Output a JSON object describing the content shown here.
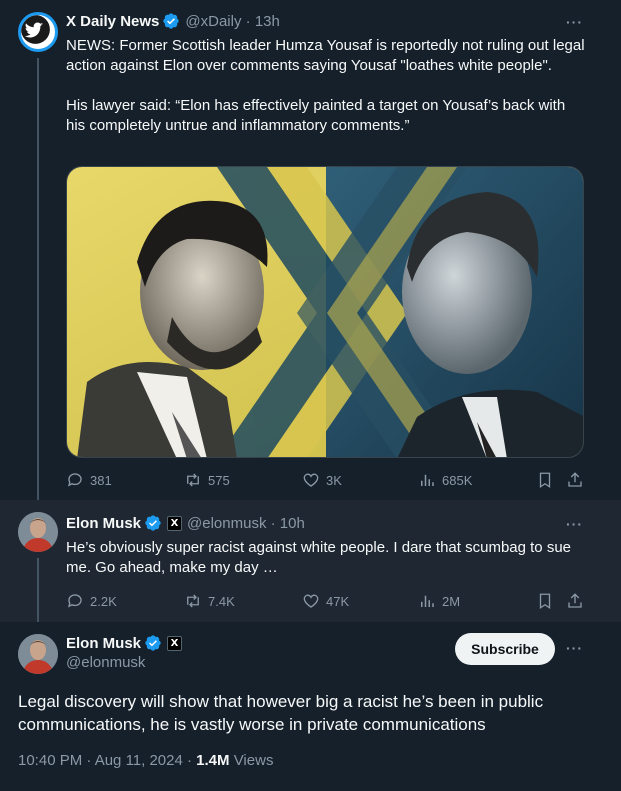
{
  "post1": {
    "name": "X Daily News",
    "handle": "@xDaily",
    "time": "13h",
    "more": "···",
    "text_p1": "NEWS: Former Scottish leader Humza Yousaf is reportedly not ruling out legal action against Elon over comments saying Yousaf \"loathes white people\".",
    "text_p2": "His lawyer said: “Elon has effectively painted a target on Yousaf’s back with his completely untrue and inflammatory comments.”",
    "replies": "381",
    "reposts": "575",
    "likes": "3K",
    "views": "685K"
  },
  "post2": {
    "name": "Elon Musk",
    "handle": "@elonmusk",
    "time": "10h",
    "more": "···",
    "affiliate_badge": "X",
    "text": "He’s obviously super racist against white people. I dare that scumbag to sue me. Go ahead, make my day …",
    "replies": "2.2K",
    "reposts": "7.4K",
    "likes": "47K",
    "views": "2M"
  },
  "post3": {
    "name": "Elon Musk",
    "handle": "@elonmusk",
    "affiliate_badge": "X",
    "subscribe_label": "Subscribe",
    "more": "···",
    "text": "Legal discovery will show that however big a racist he’s been in public communications, he is vastly worse in private communications",
    "timestamp": "10:40 PM · Aug 11, 2024 · ",
    "views_count": "1.4M",
    "views_label": "Views"
  },
  "icons": {
    "verified": "verified-badge-icon",
    "reply": "reply-icon",
    "repost": "repost-icon",
    "like": "heart-icon",
    "views": "bar-chart-icon",
    "bookmark": "bookmark-icon",
    "share": "share-icon",
    "avatar_logo": "bird-logo-icon"
  },
  "colors": {
    "background": "#15202b",
    "reply_bg": "#1e2732",
    "verified": "#1d9bf0",
    "muted": "#8b98a5",
    "text": "#f7f9f9"
  }
}
